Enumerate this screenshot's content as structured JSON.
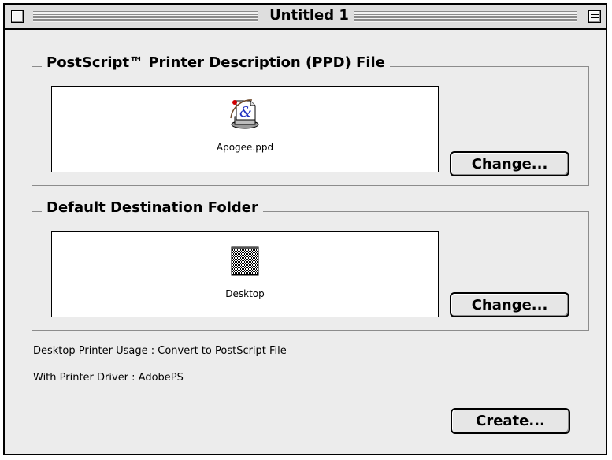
{
  "window": {
    "title": "Untitled 1"
  },
  "ppd_section": {
    "label": "PostScript™ Printer Description (PPD) File",
    "file_name": "Apogee.ppd",
    "change_label": "Change..."
  },
  "destination_section": {
    "label": "Default Destination Folder",
    "folder_name": "Desktop",
    "change_label": "Change..."
  },
  "info": {
    "usage": "Desktop Printer Usage : Convert to PostScript File",
    "driver": "With Printer Driver : AdobePS"
  },
  "create_label": "Create...",
  "icons": {
    "ppd": "ppd-file-icon",
    "folder": "desktop-folder-icon"
  }
}
